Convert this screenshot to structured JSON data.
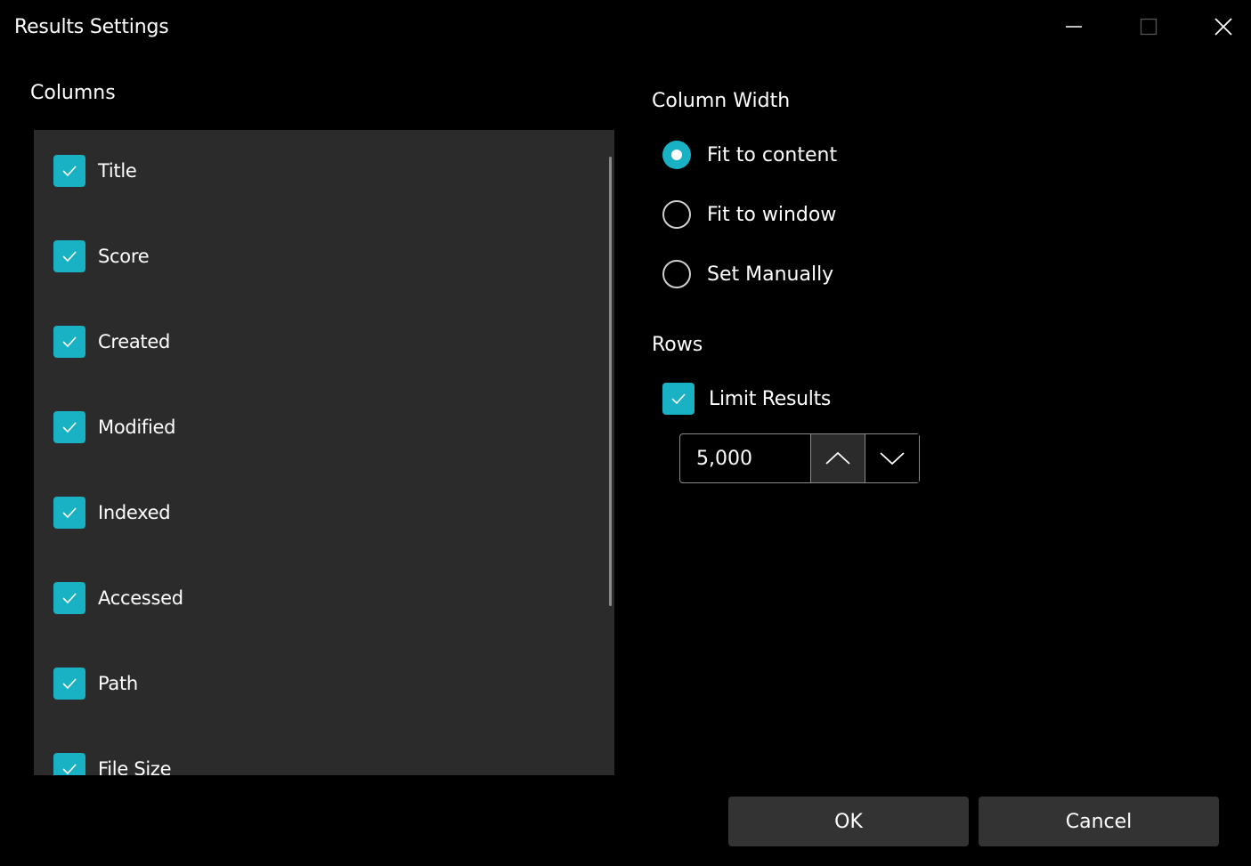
{
  "window": {
    "title": "Results Settings",
    "controls": {
      "minimize_icon": "minimize-icon",
      "maximize_icon": "maximize-icon",
      "close_icon": "close-icon"
    }
  },
  "columns": {
    "heading": "Columns",
    "items": [
      {
        "label": "Title",
        "checked": true
      },
      {
        "label": "Score",
        "checked": true
      },
      {
        "label": "Created",
        "checked": true
      },
      {
        "label": "Modified",
        "checked": true
      },
      {
        "label": "Indexed",
        "checked": true
      },
      {
        "label": "Accessed",
        "checked": true
      },
      {
        "label": "Path",
        "checked": true
      },
      {
        "label": "File Size",
        "checked": true
      }
    ]
  },
  "column_width": {
    "heading": "Column Width",
    "options": [
      {
        "label": "Fit to content",
        "selected": true
      },
      {
        "label": "Fit to window",
        "selected": false
      },
      {
        "label": "Set Manually",
        "selected": false
      }
    ]
  },
  "rows": {
    "heading": "Rows",
    "limit_results_label": "Limit Results",
    "limit_results_checked": true,
    "limit_value": "5,000"
  },
  "footer": {
    "ok_label": "OK",
    "cancel_label": "Cancel"
  },
  "colors": {
    "accent": "#19b1c4",
    "panel_background": "#2b2b2b",
    "window_background": "#000000",
    "button_background": "#333333"
  }
}
